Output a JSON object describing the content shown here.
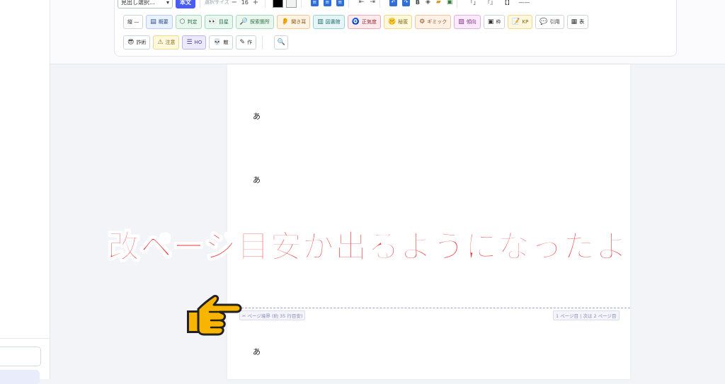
{
  "toolbar": {
    "heading_select": "見出し選択...",
    "body_button": "本文",
    "font_size_label": "選択サイズ",
    "font_size_minus": "−",
    "font_size_value": "16",
    "font_size_plus": "+",
    "color_black": "#000000",
    "color_white": "#f2f2f2",
    "indent_left": "⇤",
    "indent_right": "⇥",
    "bold": "B",
    "bracket1": "「」",
    "bracket2": "『』",
    "bracket3": "【】",
    "hr": "——",
    "row1": [
      {
        "label": "縦 —",
        "icon": ""
      },
      {
        "label": "概要",
        "icon": "doc-icon"
      },
      {
        "label": "判定",
        "icon": "cube-icon"
      },
      {
        "label": "目星",
        "icon": "eyes-icon"
      },
      {
        "label": "探索箇所",
        "icon": "magnifier-icon"
      },
      {
        "label": "聞き耳",
        "icon": "ear-icon"
      },
      {
        "label": "図書館",
        "icon": "book-icon"
      },
      {
        "label": "正気度",
        "icon": "shield-icon"
      },
      {
        "label": "秘匿",
        "icon": "shush-icon"
      },
      {
        "label": "ギミック",
        "icon": "gear-icon"
      },
      {
        "label": "傾向",
        "icon": "frame-icon"
      },
      {
        "label": "枠",
        "icon": "square-icon"
      },
      {
        "label": "KP",
        "icon": "memo-icon"
      },
      {
        "label": "引用",
        "icon": "speech-icon"
      },
      {
        "label": "表",
        "icon": "table-icon"
      }
    ],
    "row2": [
      {
        "label": "詐術",
        "icon": "sunglasses-icon"
      },
      {
        "label": "注意",
        "icon": "warning-icon"
      },
      {
        "label": "HO",
        "icon": "list-icon"
      },
      {
        "label": "敵",
        "icon": "skull-icon"
      },
      {
        "label": "作",
        "icon": "pencil-icon"
      }
    ],
    "search_icon": "search-icon"
  },
  "document": {
    "lines": [
      "あ",
      "あ",
      "あ"
    ]
  },
  "page_break": {
    "left_label": "✂ ページ境界 (約 35 行目安)",
    "right_label": "1 ページ目 | 次は 2 ページ目"
  },
  "overlay": {
    "caption": "改ページ目安が出るようになったよ",
    "caption_color": "#ee3a3e",
    "pointer_icon": "pointing-hand-icon"
  }
}
